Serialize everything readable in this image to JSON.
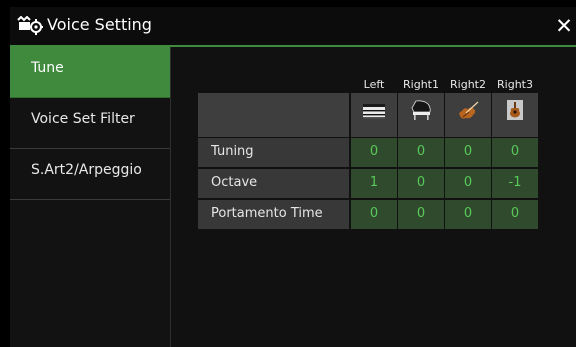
{
  "window": {
    "title": "Voice Setting",
    "close_glyph": "✕"
  },
  "sidebar": {
    "items": [
      {
        "label": "Tune",
        "active": true
      },
      {
        "label": "Voice Set Filter",
        "active": false
      },
      {
        "label": "S.Art2/Arpeggio",
        "active": false
      }
    ]
  },
  "table": {
    "columns": [
      {
        "label": "Left",
        "icon": "keyboard-icon"
      },
      {
        "label": "Right1",
        "icon": "grand-piano-icon"
      },
      {
        "label": "Right2",
        "icon": "violin-icon"
      },
      {
        "label": "Right3",
        "icon": "acoustic-guitar-icon"
      }
    ],
    "rows": [
      {
        "label": "Tuning",
        "values": [
          "0",
          "0",
          "0",
          "0"
        ]
      },
      {
        "label": "Octave",
        "values": [
          "1",
          "0",
          "0",
          "-1"
        ]
      },
      {
        "label": "Portamento Time",
        "values": [
          "0",
          "0",
          "0",
          "0"
        ]
      }
    ]
  },
  "colors": {
    "accent": "#3f8a3c",
    "value_text": "#59c95a",
    "value_bg": "#2f4a2d",
    "label_bg": "#383838"
  }
}
